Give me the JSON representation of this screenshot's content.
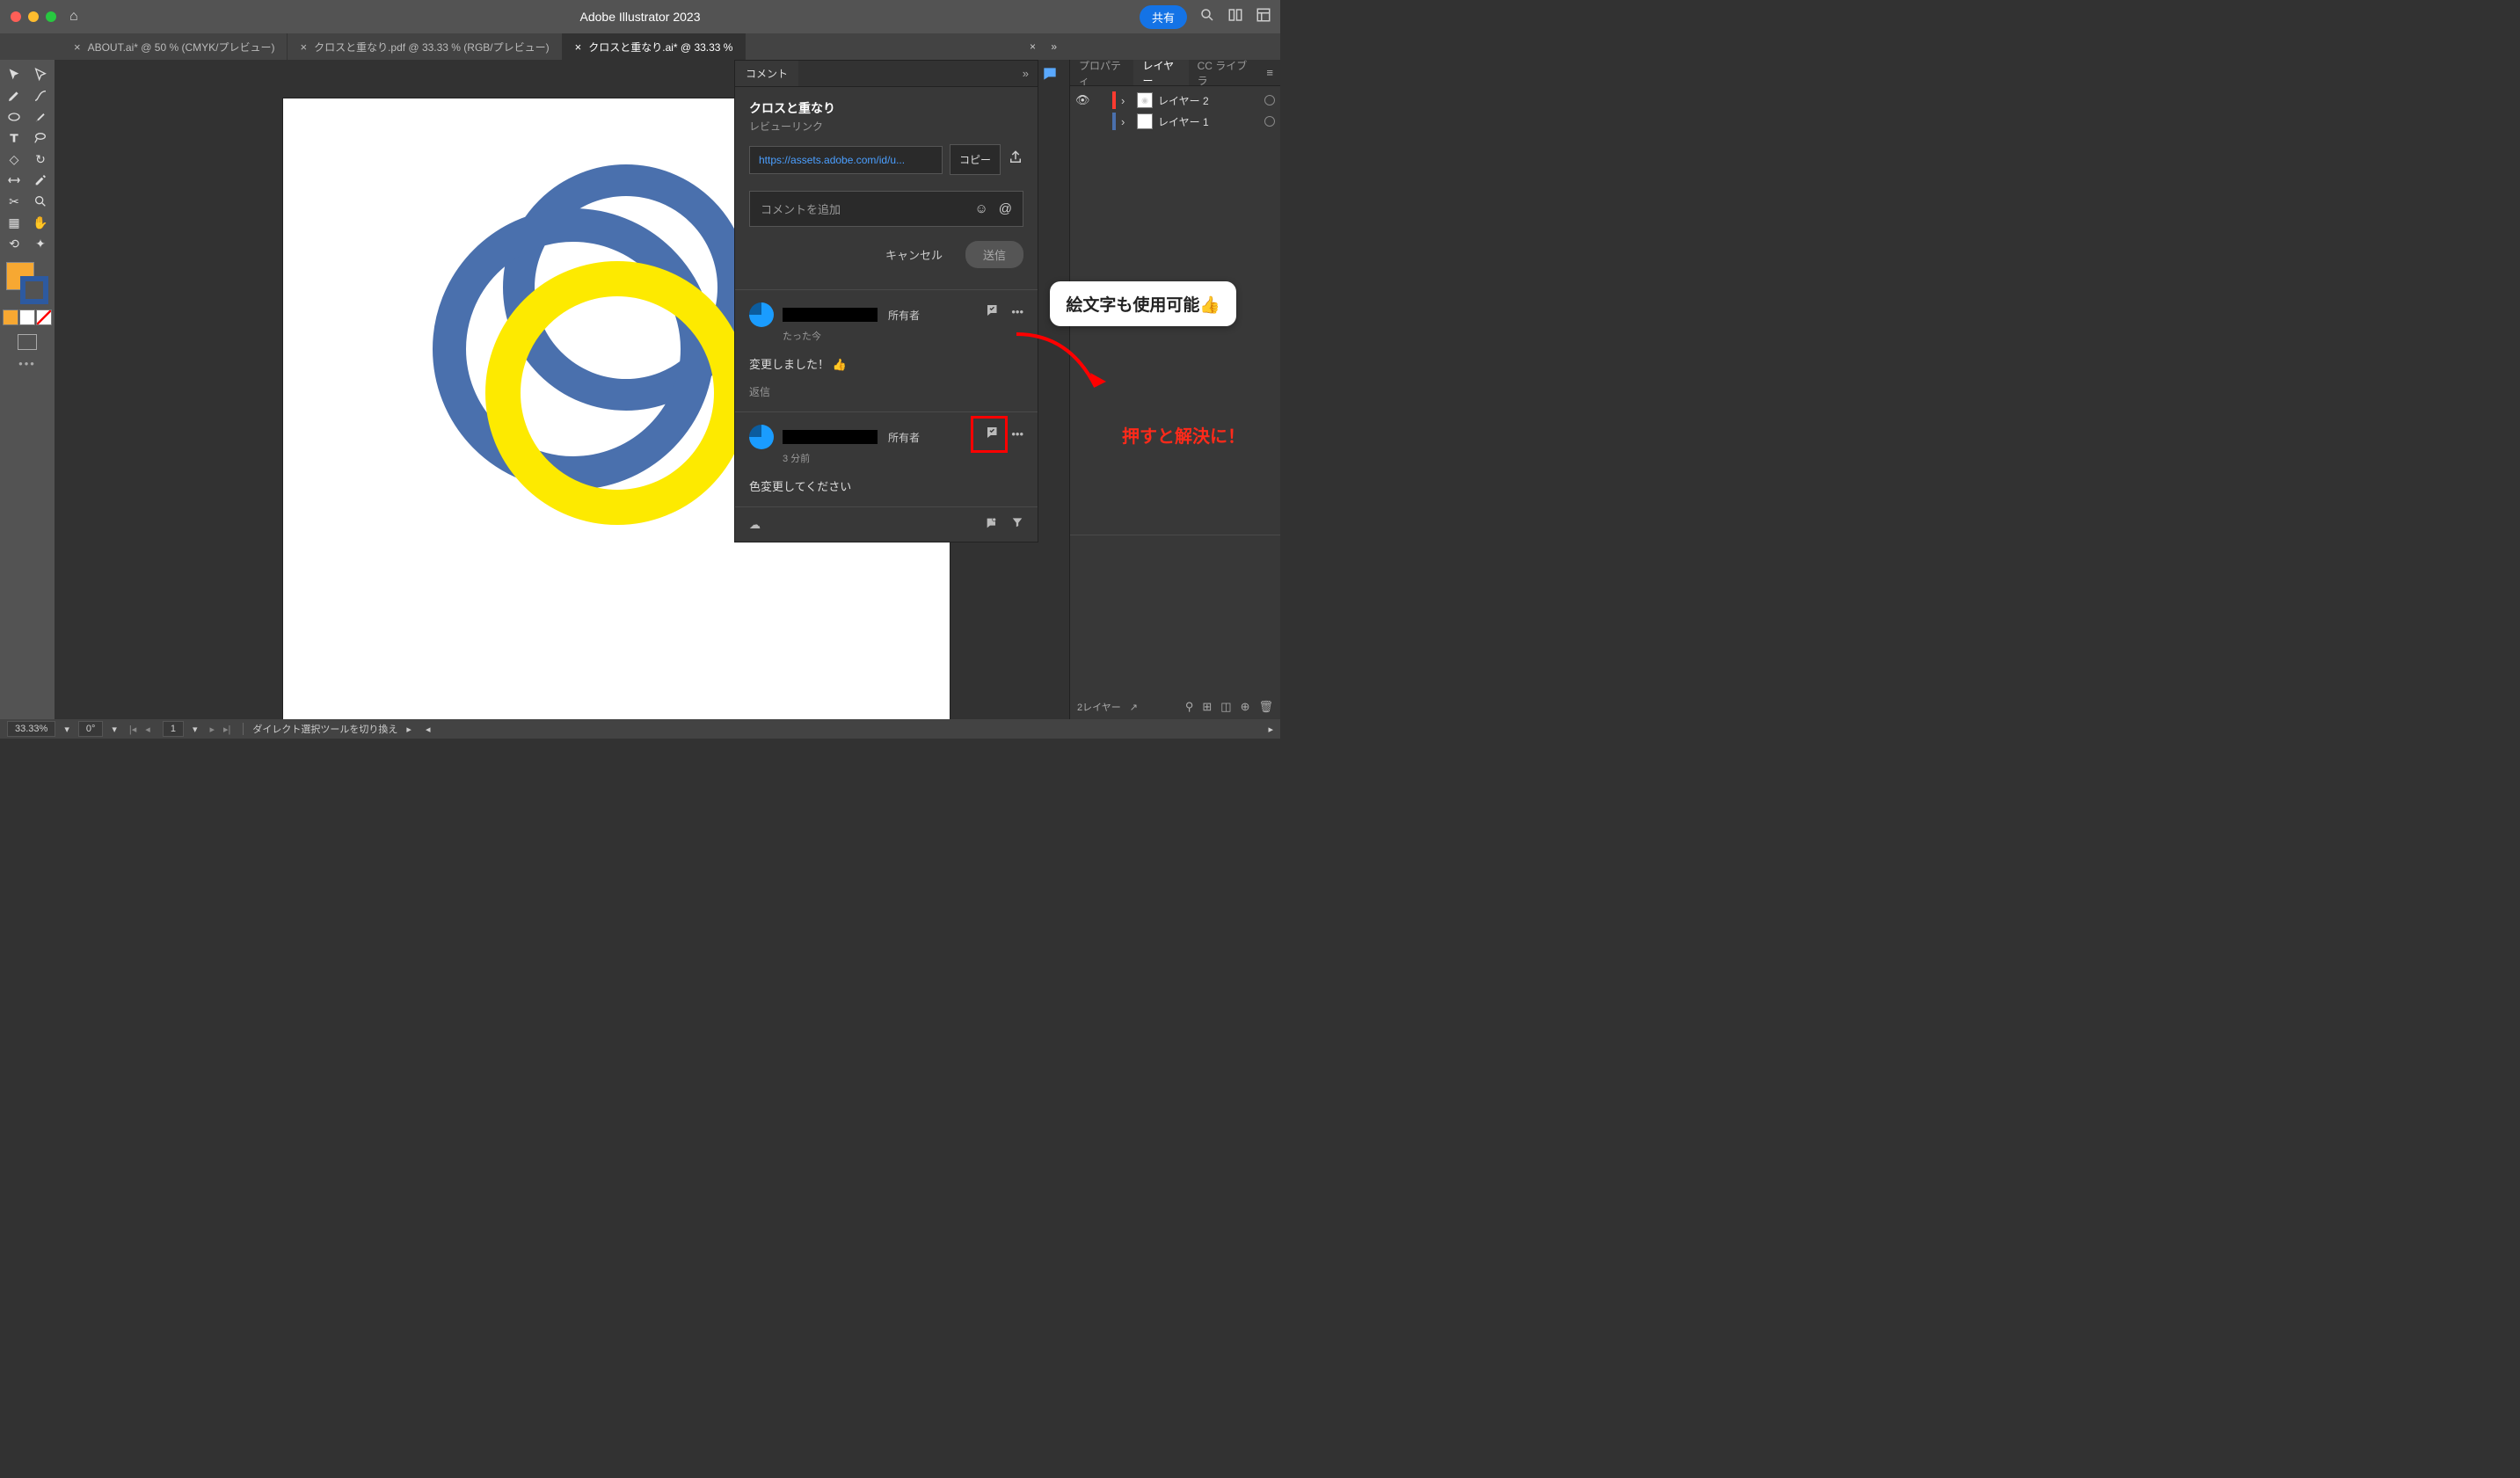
{
  "titlebar": {
    "app_title": "Adobe Illustrator 2023",
    "share_label": "共有"
  },
  "tabs": [
    {
      "label": "ABOUT.ai* @ 50 % (CMYK/プレビュー)",
      "active": false
    },
    {
      "label": "クロスと重なり.pdf @ 33.33 % (RGB/プレビュー)",
      "active": false
    },
    {
      "label": "クロスと重なり.ai* @ 33.33 %",
      "active": true
    }
  ],
  "comment_panel": {
    "tab_label": "コメント",
    "doc_title": "クロスと重なり",
    "subtitle": "レビューリンク",
    "link_url": "https://assets.adobe.com/id/u...",
    "copy_label": "コピー",
    "add_placeholder": "コメントを追加",
    "cancel_label": "キャンセル",
    "send_label": "送信",
    "comments": [
      {
        "role": "所有者",
        "time": "たった今",
        "text": "変更しました！ 👍",
        "reply_label": "返信"
      },
      {
        "role": "所有者",
        "time": "3 分前",
        "text": "色変更してください",
        "reply_label": ""
      }
    ]
  },
  "right_panel": {
    "tabs": {
      "properties": "プロパティ",
      "layers": "レイヤー",
      "cc": "CC ライブラ"
    },
    "layers": [
      {
        "name": "レイヤー 2",
        "color": "cs-red"
      },
      {
        "name": "レイヤー 1",
        "color": "cs-blue"
      }
    ],
    "footer_label": "2レイヤー"
  },
  "annotations": {
    "bubble": "絵文字も使用可能👍",
    "resolve_hint": "押すと解決に！"
  },
  "statusbar": {
    "zoom": "33.33%",
    "rotation": "0°",
    "artboard": "1",
    "hint": "ダイレクト選択ツールを切り換え"
  }
}
